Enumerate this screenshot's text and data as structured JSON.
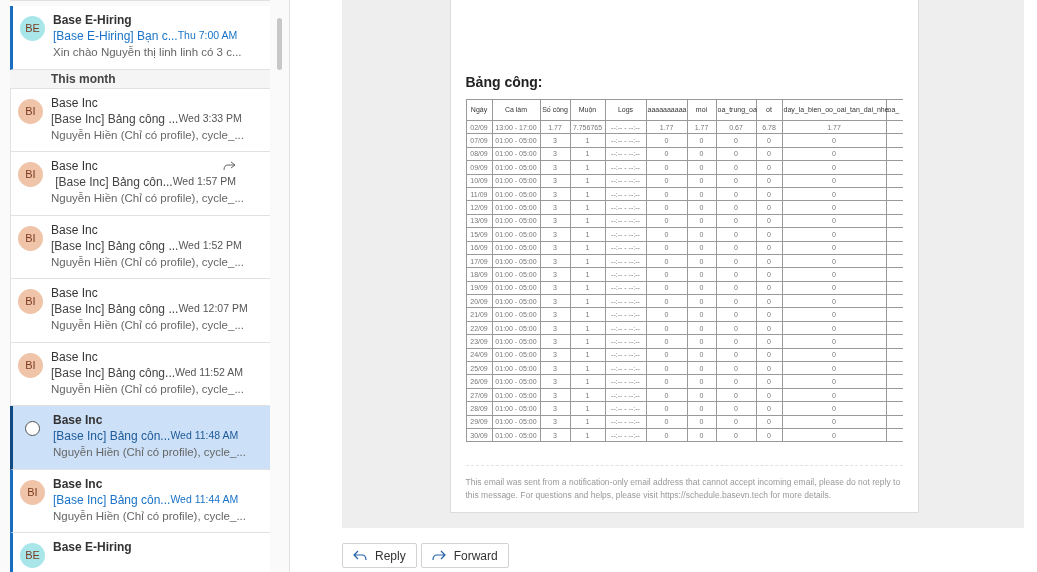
{
  "message_list": {
    "items": [
      {
        "initials": "BE",
        "color": "#a8e6ea",
        "sender": "Base E-Hiring",
        "subject": "[Base E-Hiring] Bạn c...",
        "time": "Thu 7:00 AM",
        "preview": "Xin chào Nguyễn thị linh linh có 3 c...",
        "unread": true,
        "selected": false,
        "forwarded": false
      },
      {
        "kind": "group",
        "label": "This month"
      },
      {
        "initials": "BI",
        "color": "#f0c4a8",
        "sender": "Base Inc",
        "subject": "[Base Inc] Bảng công ...",
        "time": "Wed 3:33 PM",
        "preview": "Nguyễn Hiền (Chỉ có profile), cycle_...",
        "unread": false,
        "selected": false,
        "forwarded": false
      },
      {
        "initials": "BI",
        "color": "#f0c4a8",
        "sender": "Base Inc",
        "subject": "[Base Inc] Bảng côn...",
        "time": "Wed 1:57 PM",
        "preview": "Nguyễn Hiền (Chỉ có profile), cycle_...",
        "unread": false,
        "selected": false,
        "forwarded": true
      },
      {
        "initials": "BI",
        "color": "#f0c4a8",
        "sender": "Base Inc",
        "subject": "[Base Inc] Bảng công ...",
        "time": "Wed 1:52 PM",
        "preview": "Nguyễn Hiền (Chỉ có profile), cycle_...",
        "unread": false,
        "selected": false,
        "forwarded": false
      },
      {
        "initials": "BI",
        "color": "#f0c4a8",
        "sender": "Base Inc",
        "subject": "[Base Inc] Bảng công ...",
        "time": "Wed 12:07 PM",
        "preview": "Nguyễn Hiền (Chỉ có profile), cycle_...",
        "unread": false,
        "selected": false,
        "forwarded": false
      },
      {
        "initials": "BI",
        "color": "#f0c4a8",
        "sender": "Base Inc",
        "subject": "[Base Inc] Bảng công...",
        "time": "Wed 11:52 AM",
        "preview": "Nguyễn Hiền (Chỉ có profile), cycle_...",
        "unread": false,
        "selected": false,
        "forwarded": false
      },
      {
        "sender": "Base Inc",
        "subject": "[Base Inc] Bảng côn...",
        "time": "Wed 11:48 AM",
        "preview": "Nguyễn Hiền (Chỉ có profile), cycle_...",
        "unread": true,
        "selected": true,
        "forwarded": false
      },
      {
        "initials": "BI",
        "color": "#f0c4a8",
        "sender": "Base Inc",
        "subject": "[Base Inc] Bảng côn...",
        "time": "Wed 11:44 AM",
        "preview": "Nguyễn Hiền (Chỉ có profile), cycle_...",
        "unread": true,
        "selected": false,
        "forwarded": false
      },
      {
        "initials": "BE",
        "color": "#a8e6ea",
        "sender": "Base E-Hiring",
        "unread": true,
        "selected": false,
        "forwarded": false
      }
    ]
  },
  "email": {
    "heading": "Bảng công:",
    "table": {
      "columns": [
        "Ngày",
        "Ca làm",
        "Số công",
        "Muộn",
        "Logs",
        "aaaaaaaaaa",
        "moi",
        "oa_trung_oa",
        "ot",
        "day_la_bien_oo_oai_tan_dai_nhe",
        "oa_"
      ],
      "rows": [
        [
          "02/09",
          "13:00 - 17:00",
          "1.77",
          "7.756765",
          "--:-- - --:--",
          "1.77",
          "1.77",
          "0.67",
          "6.78",
          "1.77"
        ],
        [
          "07/09",
          "01:00 - 05:00",
          "3",
          "1",
          "--:-- - --:--",
          "0",
          "0",
          "0",
          "0",
          "0"
        ],
        [
          "08/09",
          "01:00 - 05:00",
          "3",
          "1",
          "--:-- - --:--",
          "0",
          "0",
          "0",
          "0",
          "0"
        ],
        [
          "09/09",
          "01:00 - 05:00",
          "3",
          "1",
          "--:-- - --:--",
          "0",
          "0",
          "0",
          "0",
          "0"
        ],
        [
          "10/09",
          "01:00 - 05:00",
          "3",
          "1",
          "--:-- - --:--",
          "0",
          "0",
          "0",
          "0",
          "0"
        ],
        [
          "11/09",
          "01:00 - 05:00",
          "3",
          "1",
          "--:-- - --:--",
          "0",
          "0",
          "0",
          "0",
          "0"
        ],
        [
          "12/09",
          "01:00 - 05:00",
          "3",
          "1",
          "--:-- - --:--",
          "0",
          "0",
          "0",
          "0",
          "0"
        ],
        [
          "13/09",
          "01:00 - 05:00",
          "3",
          "1",
          "--:-- - --:--",
          "0",
          "0",
          "0",
          "0",
          "0"
        ],
        [
          "15/09",
          "01:00 - 05:00",
          "3",
          "1",
          "--:-- - --:--",
          "0",
          "0",
          "0",
          "0",
          "0"
        ],
        [
          "16/09",
          "01:00 - 05:00",
          "3",
          "1",
          "--:-- - --:--",
          "0",
          "0",
          "0",
          "0",
          "0"
        ],
        [
          "17/09",
          "01:00 - 05:00",
          "3",
          "1",
          "--:-- - --:--",
          "0",
          "0",
          "0",
          "0",
          "0"
        ],
        [
          "18/09",
          "01:00 - 05:00",
          "3",
          "1",
          "--:-- - --:--",
          "0",
          "0",
          "0",
          "0",
          "0"
        ],
        [
          "19/09",
          "01:00 - 05:00",
          "3",
          "1",
          "--:-- - --:--",
          "0",
          "0",
          "0",
          "0",
          "0"
        ],
        [
          "20/09",
          "01:00 - 05:00",
          "3",
          "1",
          "--:-- - --:--",
          "0",
          "0",
          "0",
          "0",
          "0"
        ],
        [
          "21/09",
          "01:00 - 05:00",
          "3",
          "1",
          "--:-- - --:--",
          "0",
          "0",
          "0",
          "0",
          "0"
        ],
        [
          "22/09",
          "01:00 - 05:00",
          "3",
          "1",
          "--:-- - --:--",
          "0",
          "0",
          "0",
          "0",
          "0"
        ],
        [
          "23/09",
          "01:00 - 05:00",
          "3",
          "1",
          "--:-- - --:--",
          "0",
          "0",
          "0",
          "0",
          "0"
        ],
        [
          "24/09",
          "01:00 - 05:00",
          "3",
          "1",
          "--:-- - --:--",
          "0",
          "0",
          "0",
          "0",
          "0"
        ],
        [
          "25/09",
          "01:00 - 05:00",
          "3",
          "1",
          "--:-- - --:--",
          "0",
          "0",
          "0",
          "0",
          "0"
        ],
        [
          "26/09",
          "01:00 - 05:00",
          "3",
          "1",
          "--:-- - --:--",
          "0",
          "0",
          "0",
          "0",
          "0"
        ],
        [
          "27/09",
          "01:00 - 05:00",
          "3",
          "1",
          "--:-- - --:--",
          "0",
          "0",
          "0",
          "0",
          "0"
        ],
        [
          "28/09",
          "01:00 - 05:00",
          "3",
          "1",
          "--:-- - --:--",
          "0",
          "0",
          "0",
          "0",
          "0"
        ],
        [
          "29/09",
          "01:00 - 05:00",
          "3",
          "1",
          "--:-- - --:--",
          "0",
          "0",
          "0",
          "0",
          "0"
        ],
        [
          "30/09",
          "01:00 - 05:00",
          "3",
          "1",
          "--:-- - --:--",
          "0",
          "0",
          "0",
          "0",
          "0"
        ]
      ]
    },
    "footer": "This email was sent from a notification-only email address that cannot accept incoming email, please do not reply to this message. For questions and helps, please visit https://schedule.basevn.tech for more details."
  },
  "actions": [
    "Reply",
    "Forward"
  ]
}
